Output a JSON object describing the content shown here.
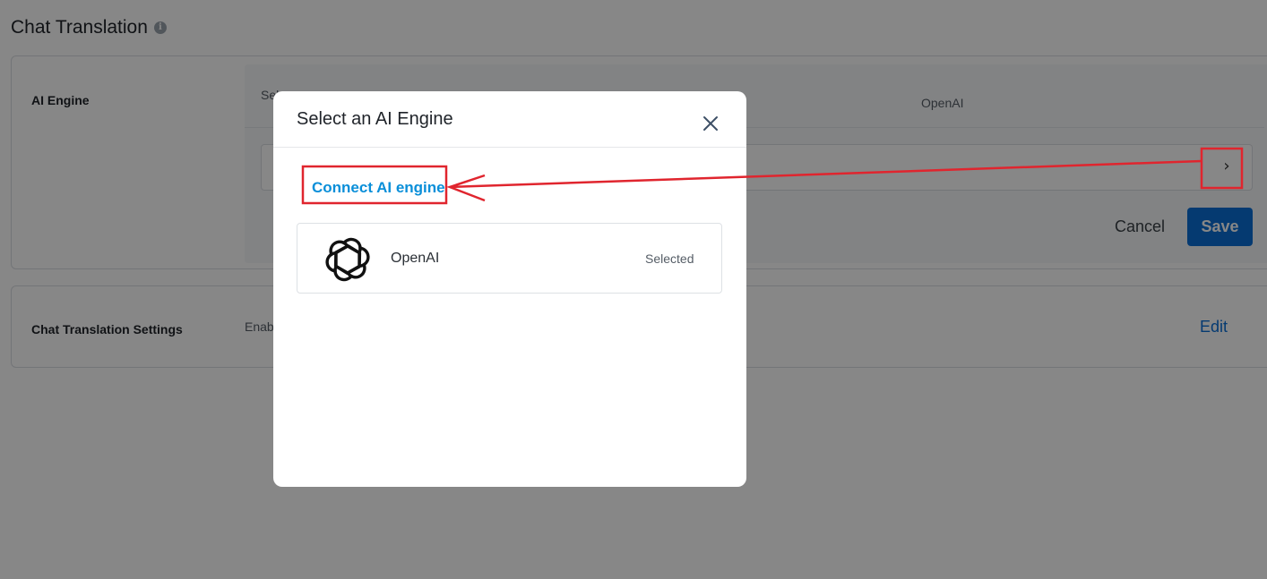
{
  "page": {
    "title": "Chat Translation"
  },
  "ai_engine_card": {
    "label": "AI Engine",
    "field_label": "Sel",
    "field_value": "OpenAI",
    "cancel_label": "Cancel",
    "save_label": "Save"
  },
  "settings_card": {
    "label": "Chat Translation Settings",
    "value": "Enab",
    "edit_label": "Edit"
  },
  "modal": {
    "title": "Select an AI Engine",
    "connect_label": "Connect AI engine",
    "options": [
      {
        "name": "OpenAI",
        "status": "Selected",
        "icon": "openai-logo-icon"
      }
    ]
  },
  "annotation": {
    "color": "#e0252e"
  },
  "colors": {
    "accent": "#0a6fd6",
    "link": "#0a8fd9"
  }
}
